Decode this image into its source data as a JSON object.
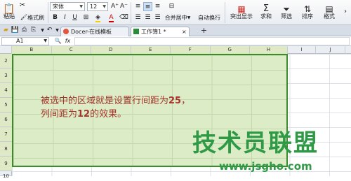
{
  "ribbon": {
    "paste_label": "粘贴",
    "cut_icon": "scissors-icon",
    "format_painter_label": "格式刷",
    "font_name": "宋体",
    "font_size": "12",
    "bold": "B",
    "italic": "I",
    "underline": "U",
    "merge_label": "合并居中",
    "wrap_label": "自动换行",
    "highlight_label": "突出显示",
    "sum_label": "求和",
    "filter_label": "筛选",
    "sort_label": "排序",
    "format_label": "格式"
  },
  "tabs": {
    "doc_tab": "Docer-在线模板",
    "workbook_tab": "工作簿1 *",
    "add_tab": "+"
  },
  "formula_bar": {
    "name_box": "A1",
    "fx": "fx",
    "value": ""
  },
  "grid": {
    "columns": [
      "B",
      "C",
      "D",
      "E",
      "F",
      "G",
      "H",
      "I",
      "J"
    ],
    "rows": [
      "2",
      "3",
      "4",
      "5",
      "6",
      "7",
      "8",
      "9",
      "10"
    ]
  },
  "note": {
    "line1_prefix": "被选中的区域就是设置行间距为",
    "line1_num": "25",
    "line1_suffix": "，",
    "line2_prefix": "列间距为",
    "line2_num": "12",
    "line2_suffix": "的效果。"
  },
  "watermark": {
    "title": "技术员联盟",
    "url": "www.jsgho.com"
  },
  "colors": {
    "selection_fill": "#dbecc6",
    "selection_border": "#3b8d2b",
    "note_text": "#a6342c",
    "watermark": "#2f9a45"
  }
}
